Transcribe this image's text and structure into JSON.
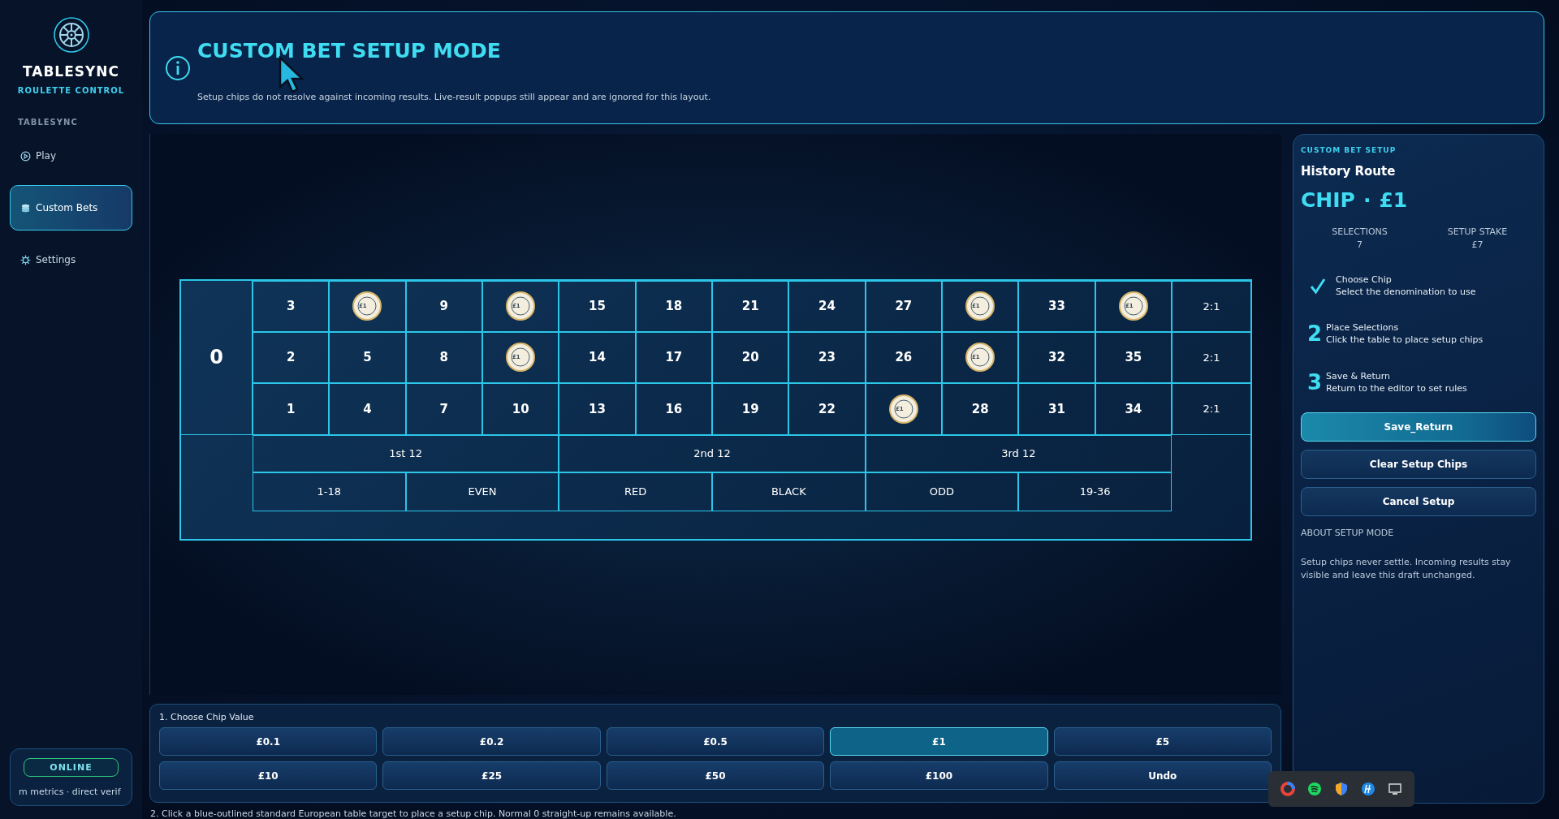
{
  "brand": {
    "title": "TABLESYNC",
    "subtitle": "ROULETTE CONTROL"
  },
  "sidebar": {
    "section": "TABLESYNC",
    "items": [
      {
        "label": "Play",
        "selected": false
      },
      {
        "label": "Custom Bets",
        "selected": true
      },
      {
        "label": "Settings",
        "selected": false
      }
    ]
  },
  "status": {
    "badge": "ONLINE",
    "text": "m metrics · direct verif"
  },
  "banner": {
    "title": "CUSTOM BET SETUP MODE",
    "text": "Setup chips do not resolve against incoming results. Live-result popups still appear and are ignored for this layout."
  },
  "table": {
    "zero": "0",
    "rows": [
      {
        "cells": [
          {
            "label": "3"
          },
          {
            "chip": "£1"
          },
          {
            "label": "9"
          },
          {
            "chip": "£1"
          },
          {
            "label": "15"
          },
          {
            "label": "18"
          },
          {
            "label": "21"
          },
          {
            "label": "24"
          },
          {
            "label": "27"
          },
          {
            "chip": "£1"
          },
          {
            "label": "33"
          },
          {
            "chip": "£1"
          }
        ],
        "column_bet": "2:1"
      },
      {
        "cells": [
          {
            "label": "2"
          },
          {
            "label": "5"
          },
          {
            "label": "8"
          },
          {
            "chip": "£1"
          },
          {
            "label": "14"
          },
          {
            "label": "17"
          },
          {
            "label": "20"
          },
          {
            "label": "23"
          },
          {
            "label": "26"
          },
          {
            "chip": "£1"
          },
          {
            "label": "32"
          },
          {
            "label": "35"
          }
        ],
        "column_bet": "2:1"
      },
      {
        "cells": [
          {
            "label": "1"
          },
          {
            "label": "4"
          },
          {
            "label": "7"
          },
          {
            "label": "10"
          },
          {
            "label": "13"
          },
          {
            "label": "16"
          },
          {
            "label": "19"
          },
          {
            "label": "22"
          },
          {
            "chip": "£1"
          },
          {
            "label": "28"
          },
          {
            "label": "31"
          },
          {
            "label": "34"
          }
        ],
        "column_bet": "2:1"
      }
    ],
    "dozens": [
      "1st 12",
      "2nd 12",
      "3rd 12"
    ],
    "outside": [
      "1-18",
      "EVEN",
      "RED",
      "BLACK",
      "ODD",
      "19-36"
    ]
  },
  "chip_picker": {
    "title": "1. Choose Chip Value",
    "buttons": [
      {
        "label": "£0.1",
        "selected": false
      },
      {
        "label": "£0.2",
        "selected": false
      },
      {
        "label": "£0.5",
        "selected": false
      },
      {
        "label": "£1",
        "selected": true
      },
      {
        "label": "£5",
        "selected": false
      },
      {
        "label": "£10",
        "selected": false
      },
      {
        "label": "£25",
        "selected": false
      },
      {
        "label": "£50",
        "selected": false
      },
      {
        "label": "£100",
        "selected": false
      },
      {
        "label": "Undo",
        "selected": false
      }
    ]
  },
  "footnote": "2. Click a blue-outlined standard European table target to place a setup chip. Normal 0 straight-up remains available.",
  "setup_panel": {
    "eyebrow": "CUSTOM BET SETUP",
    "route": "History Route",
    "chip_prefix": "CHIP",
    "chip_sep": "·",
    "chip_value": "£1",
    "stats": [
      {
        "label": "SELECTIONS",
        "value": "7"
      },
      {
        "label": "SETUP STAKE",
        "value": "£7"
      }
    ],
    "steps": [
      {
        "completed": true,
        "title": "Choose Chip",
        "text": "Select the denomination to use"
      },
      {
        "completed": false,
        "marker": "2",
        "title": "Place Selections",
        "text": "Click the table to place setup chips"
      },
      {
        "completed": false,
        "marker": "3",
        "title": "Save & Return",
        "text": "Return to the editor to set rules"
      }
    ],
    "buttons": [
      {
        "label": "Save_Return",
        "kind": "primary"
      },
      {
        "label": "Clear Setup Chips",
        "kind": "secondary"
      },
      {
        "label": "Cancel Setup",
        "kind": "secondary"
      }
    ],
    "about_title": "ABOUT SETUP MODE",
    "about_text": "Setup chips never settle. Incoming results stay visible and leave this draft unchanged."
  }
}
